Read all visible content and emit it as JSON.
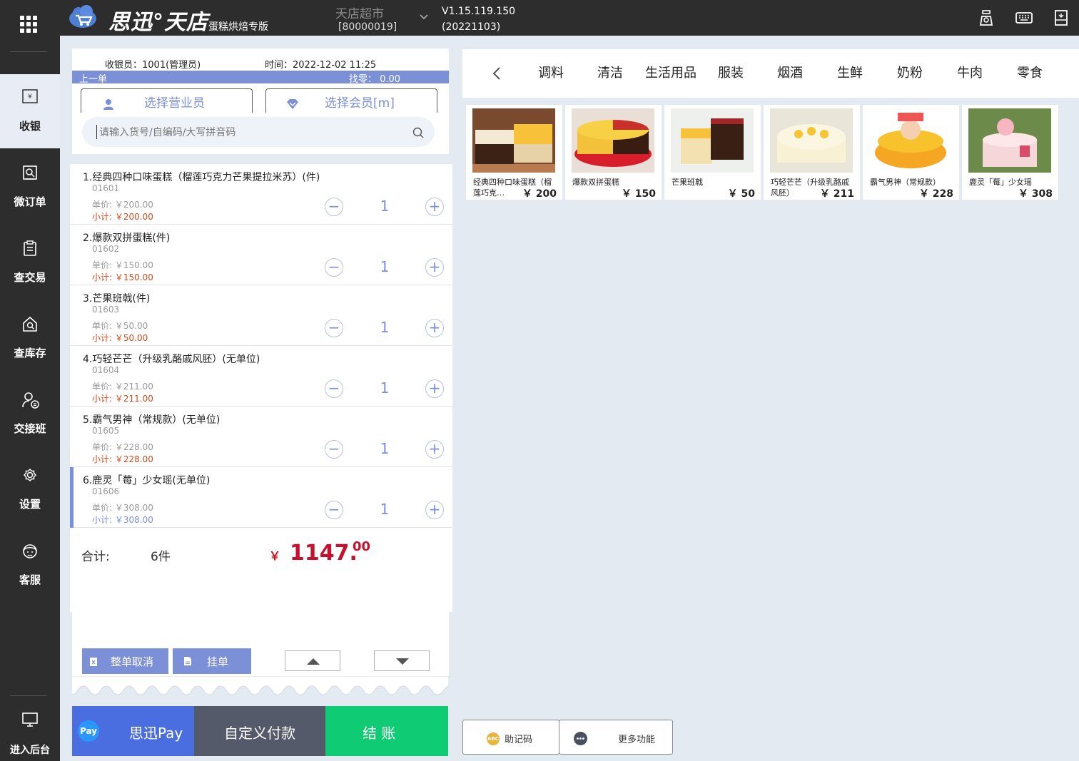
{
  "topbar": {
    "logo_text": "思迅°天店",
    "edition": "蛋糕烘焙专版",
    "store_name": "天店超市",
    "store_id": "[80000019]",
    "version": "V1.15.119.150",
    "version_date": "(20221103)"
  },
  "nav": {
    "items": [
      {
        "label": "收银",
        "icon": "cashier-icon"
      },
      {
        "label": "微订单",
        "icon": "micro-order-icon"
      },
      {
        "label": "查交易",
        "icon": "transactions-icon"
      },
      {
        "label": "查库存",
        "icon": "inventory-icon"
      },
      {
        "label": "交接班",
        "icon": "shift-handover-icon"
      },
      {
        "label": "设置",
        "icon": "gear-icon"
      },
      {
        "label": "客服",
        "icon": "support-icon"
      }
    ],
    "backend_label": "进入后台"
  },
  "cart": {
    "cashier": "收银员：1001(管理员)",
    "time": "时间：2022-12-02 11:25",
    "last_order": "上一单",
    "change": "找零：  0.00",
    "select_staff": "选择营业员",
    "select_member": "选择会员[m]",
    "search_placeholder": "请输入货号/自编码/大写拼音码",
    "items": [
      {
        "name": "1.经典四种口味蛋糕（榴莲巧克力芒果提拉米苏）(件)",
        "code": "01601",
        "unit_price": "单价: ￥200.00",
        "subtotal": "小计: ￥200.00",
        "qty": "1"
      },
      {
        "name": "2.爆款双拼蛋糕(件)",
        "code": "01602",
        "unit_price": "单价: ￥150.00",
        "subtotal": "小计: ￥150.00",
        "qty": "1"
      },
      {
        "name": "3.芒果班戟(件)",
        "code": "01603",
        "unit_price": "单价: ￥50.00",
        "subtotal": "小计: ￥50.00",
        "qty": "1"
      },
      {
        "name": "4.巧轻芒芒（升级乳酪戚风胚）(无单位)",
        "code": "01604",
        "unit_price": "单价: ￥211.00",
        "subtotal": "小计: ￥211.00",
        "qty": "1"
      },
      {
        "name": "5.霸气男神（常规款）(无单位)",
        "code": "01605",
        "unit_price": "单价: ￥228.00",
        "subtotal": "小计: ￥228.00",
        "qty": "1"
      },
      {
        "name": "6.鹿灵「莓」少女瑶(无单位)",
        "code": "01606",
        "unit_price": "单价: ￥308.00",
        "subtotal": "小计: ￥308.00",
        "qty": "1"
      }
    ],
    "total_label": "合计:",
    "total_count": "6件",
    "total_yen": "￥",
    "total_int": "1147.",
    "total_dec": "00",
    "cancel_all": "整单取消",
    "hold": "挂单",
    "pay_sixun": "思迅Pay",
    "pay_badge": "Pay",
    "pay_custom": "自定义付款",
    "checkout": "结  账"
  },
  "categories": {
    "items": [
      "调料",
      "清洁",
      "生活用品",
      "服装",
      "烟酒",
      "生鲜",
      "奶粉",
      "牛肉",
      "零食"
    ]
  },
  "products": [
    {
      "name": "经典四种口味蛋糕（榴莲巧克…",
      "price": "￥ 200"
    },
    {
      "name": "爆款双拼蛋糕",
      "price": "￥ 150"
    },
    {
      "name": "芒果班戟",
      "price": "￥ 50"
    },
    {
      "name": "巧轻芒芒（升级乳酪戚风胚）",
      "price": "￥ 211"
    },
    {
      "name": "霸气男神（常规款）",
      "price": "￥ 228"
    },
    {
      "name": "鹿灵「莓」少女瑶",
      "price": "￥ 308"
    }
  ],
  "bottom": {
    "mnemonic": "助记码",
    "more": "更多功能"
  },
  "colors": {
    "accent": "#7b90d6",
    "checkout_green": "#0fcb73",
    "pay_blue": "#4a6ee0",
    "custom_gray": "#555a6b",
    "total_red": "#c8102e"
  }
}
